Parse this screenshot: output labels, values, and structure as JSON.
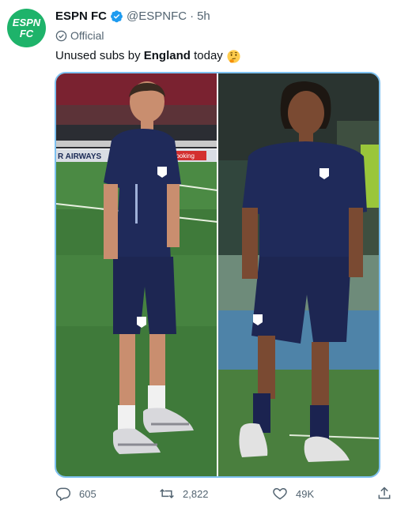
{
  "account": {
    "name": "ESPN FC",
    "handle": "@ESPNFC",
    "separator": "·",
    "time": "5h",
    "label": "Official",
    "logo_text_top": "ESPN",
    "logo_text_bottom": "FC"
  },
  "tweet": {
    "text_before": "Unused subs by",
    "text_bold": "England",
    "text_after": "today",
    "emoji": "thinking-face"
  },
  "actions": {
    "replies": "605",
    "retweets": "2,822",
    "likes": "49K"
  },
  "photo_left": {
    "ad_board_text": "R AIRWAYS",
    "ad_board_text_2": "Booking"
  },
  "colors": {
    "brand_green": "#1eb36a",
    "verified_blue": "#1d9bf0",
    "text": "#0f1419",
    "muted": "#536471",
    "media_border": "#7ec1f0"
  }
}
